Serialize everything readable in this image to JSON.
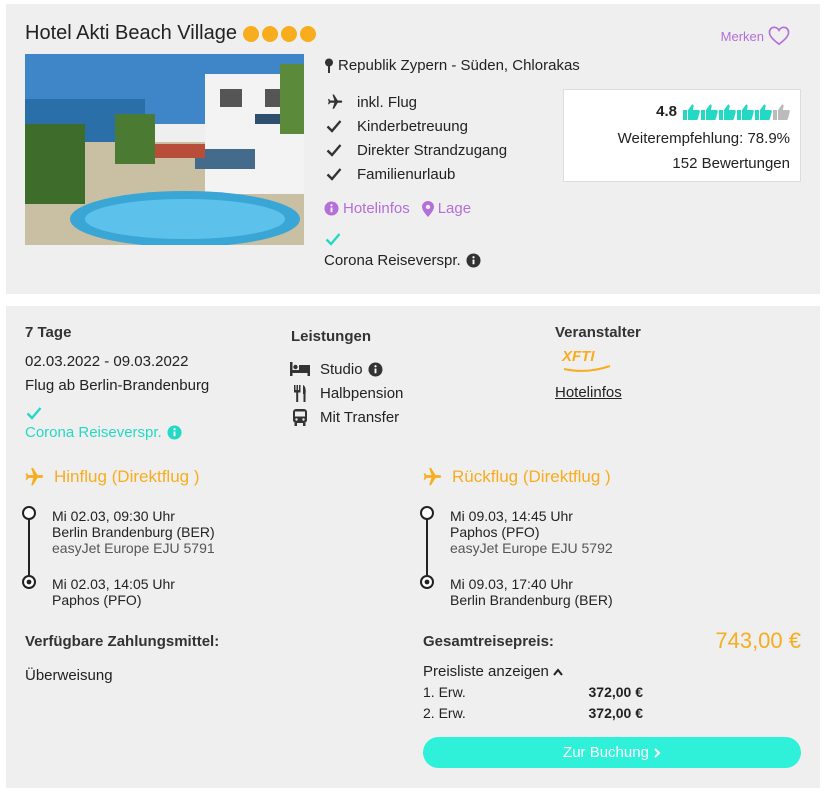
{
  "hotel": {
    "name": "Hotel Akti Beach Village",
    "stars": 4,
    "merken_label": "Merken",
    "location": "Republik Zypern - Süden, Chlorakas",
    "features": [
      "inkl. Flug",
      "Kinderbetreuung",
      "Direkter Strandzugang",
      "Familienurlaub"
    ],
    "links": {
      "hotelinfos": "Hotelinfos",
      "lage": "Lage"
    },
    "corona": "Corona Reiseverspr."
  },
  "rating": {
    "score": "4.8",
    "thumbs_filled": 5,
    "thumbs_total": 6,
    "recommendation": "Weiterempfehlung: 78.9%",
    "reviews": "152 Bewertungen"
  },
  "offer": {
    "duration": "7 Tage",
    "dates": "02.03.2022 - 09.03.2022",
    "departure": "Flug ab Berlin-Brandenburg",
    "corona": "Corona Reiseverspr.",
    "services_heading": "Leistungen",
    "services": [
      "Studio",
      "Halbpension",
      "Mit Transfer"
    ],
    "operator_heading": "Veranstalter",
    "operator_logo": "XFTI",
    "operator_link": "Hotelinfos"
  },
  "outbound": {
    "title": "Hinflug (Direktflug )",
    "dep_time": "Mi 02.03, 09:30 Uhr",
    "dep_airport": "Berlin Brandenburg (BER)",
    "airline": "easyJet Europe EJU 5791",
    "arr_time": "Mi 02.03, 14:05 Uhr",
    "arr_airport": "Paphos (PFO)"
  },
  "return": {
    "title": "Rückflug (Direktflug )",
    "dep_time": "Mi 09.03, 14:45 Uhr",
    "dep_airport": "Paphos (PFO)",
    "airline": "easyJet Europe EJU 5792",
    "arr_time": "Mi 09.03, 17:40 Uhr",
    "arr_airport": "Berlin Brandenburg (BER)"
  },
  "payment": {
    "heading": "Verfügbare Zahlungsmittel:",
    "method": "Überweisung"
  },
  "price": {
    "heading": "Gesamtreisepreis:",
    "total": "743,00 €",
    "pricelist_label": "Preisliste anzeigen",
    "rows": [
      {
        "label": "1. Erw.",
        "value": "372,00 €"
      },
      {
        "label": "2. Erw.",
        "value": "372,00 €"
      }
    ],
    "button": "Zur Buchung"
  },
  "colors": {
    "accent_orange": "#f7ad1e",
    "accent_teal": "#24d9c4",
    "accent_purple": "#b46fd8",
    "button": "#2ff0d8"
  }
}
